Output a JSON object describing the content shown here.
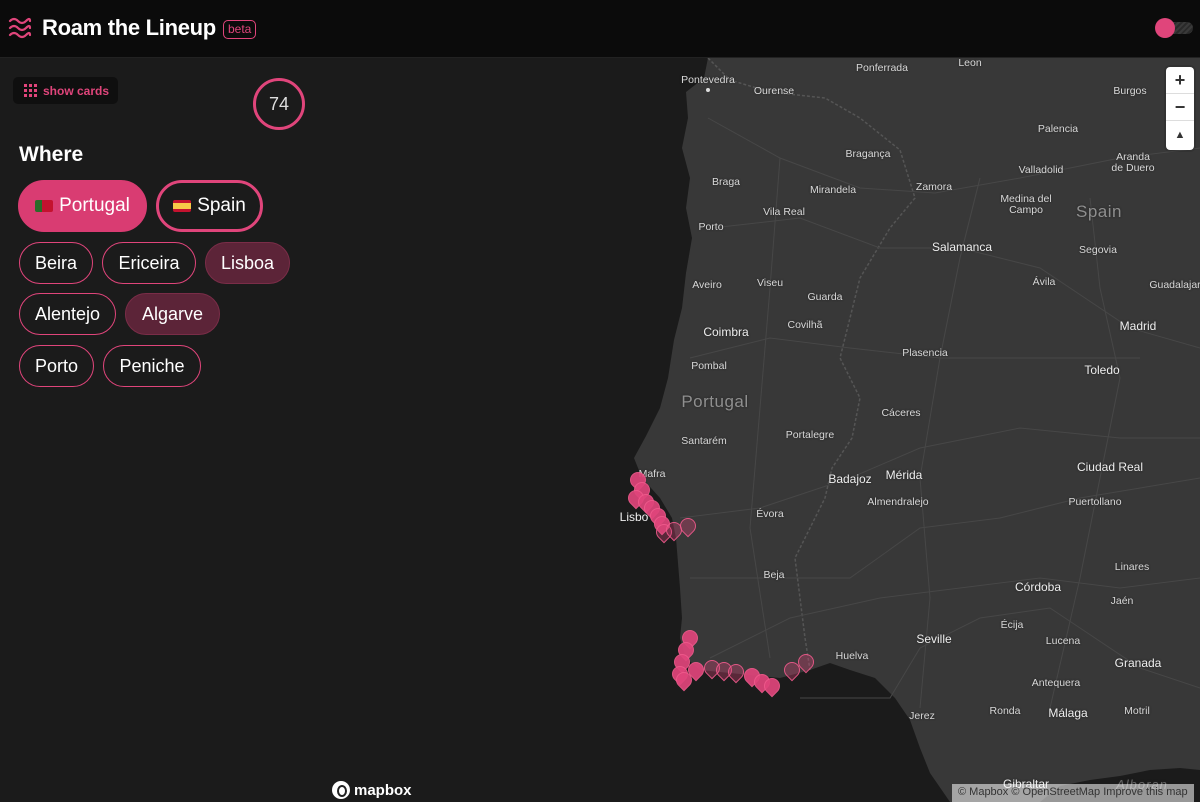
{
  "header": {
    "title": "Roam the Lineup",
    "badge": "beta",
    "logo_icon": "waves-icon",
    "accent_color": "#e0457b"
  },
  "sidebar": {
    "show_cards_label": "show cards",
    "show_cards_icon": "grid-icon",
    "count": "74",
    "where_heading": "Where",
    "countries": [
      {
        "label": "Portugal",
        "flag": "flag-portugal-icon",
        "state": "active"
      },
      {
        "label": "Spain",
        "flag": "flag-spain-icon",
        "state": "outlined"
      }
    ],
    "regions": [
      {
        "label": "Beira",
        "selected": false
      },
      {
        "label": "Ericeira",
        "selected": false
      },
      {
        "label": "Lisboa",
        "selected": true
      },
      {
        "label": "Alentejo",
        "selected": false
      },
      {
        "label": "Algarve",
        "selected": true
      },
      {
        "label": "Porto",
        "selected": false
      },
      {
        "label": "Peniche",
        "selected": false
      }
    ]
  },
  "map": {
    "zoom_in": "+",
    "zoom_out": "−",
    "compass": "▲",
    "attribution": "© Mapbox © OpenStreetMap Improve this map",
    "logo_text": "mapbox",
    "labels": {
      "pontevedra": "Pontevedra",
      "ponferrada": "Ponferrada",
      "leon": "Leon",
      "ourense": "Ourense",
      "burgos": "Burgos",
      "braganca": "Bragança",
      "palencia": "Palencia",
      "braga": "Braga",
      "mirandela": "Mirandela",
      "vila_real": "Vila Real",
      "zamora": "Zamora",
      "valladolid": "Valladolid",
      "aranda": "Aranda\nde Duero",
      "medina": "Medina del\nCampo",
      "spain": "Spain",
      "porto": "Porto",
      "salamanca": "Salamanca",
      "segovia": "Segovia",
      "aveiro": "Aveiro",
      "viseu": "Viseu",
      "guarda": "Guarda",
      "avila": "Ávila",
      "guadalajara": "Guadalajar",
      "coimbra": "Coimbra",
      "covilha": "Covilhã",
      "madrid": "Madrid",
      "plasencia": "Plasencia",
      "pombal": "Pombal",
      "toledo": "Toledo",
      "portugal": "Portugal",
      "caceres": "Cáceres",
      "santarem": "Santarém",
      "portalegre": "Portalegre",
      "mafra": "Mafra",
      "badajoz": "Badajoz",
      "merida": "Mérida",
      "ciudad_real": "Ciudad Real",
      "almendralejo": "Almendralejo",
      "lisboa": "Lisbo",
      "evora": "Évora",
      "puertollano": "Puertollano",
      "beja": "Beja",
      "linares": "Linares",
      "cordoba": "Córdoba",
      "jaen": "Jaén",
      "seville": "Seville",
      "ecija": "Écija",
      "lucena": "Lucena",
      "huelva": "Huelva",
      "granada": "Granada",
      "antequera": "Antequera",
      "jerez": "Jerez",
      "ronda": "Ronda",
      "malaga": "Málaga",
      "motril": "Motril",
      "gibraltar": "Gibraltar",
      "alboran": "Alboran"
    }
  }
}
